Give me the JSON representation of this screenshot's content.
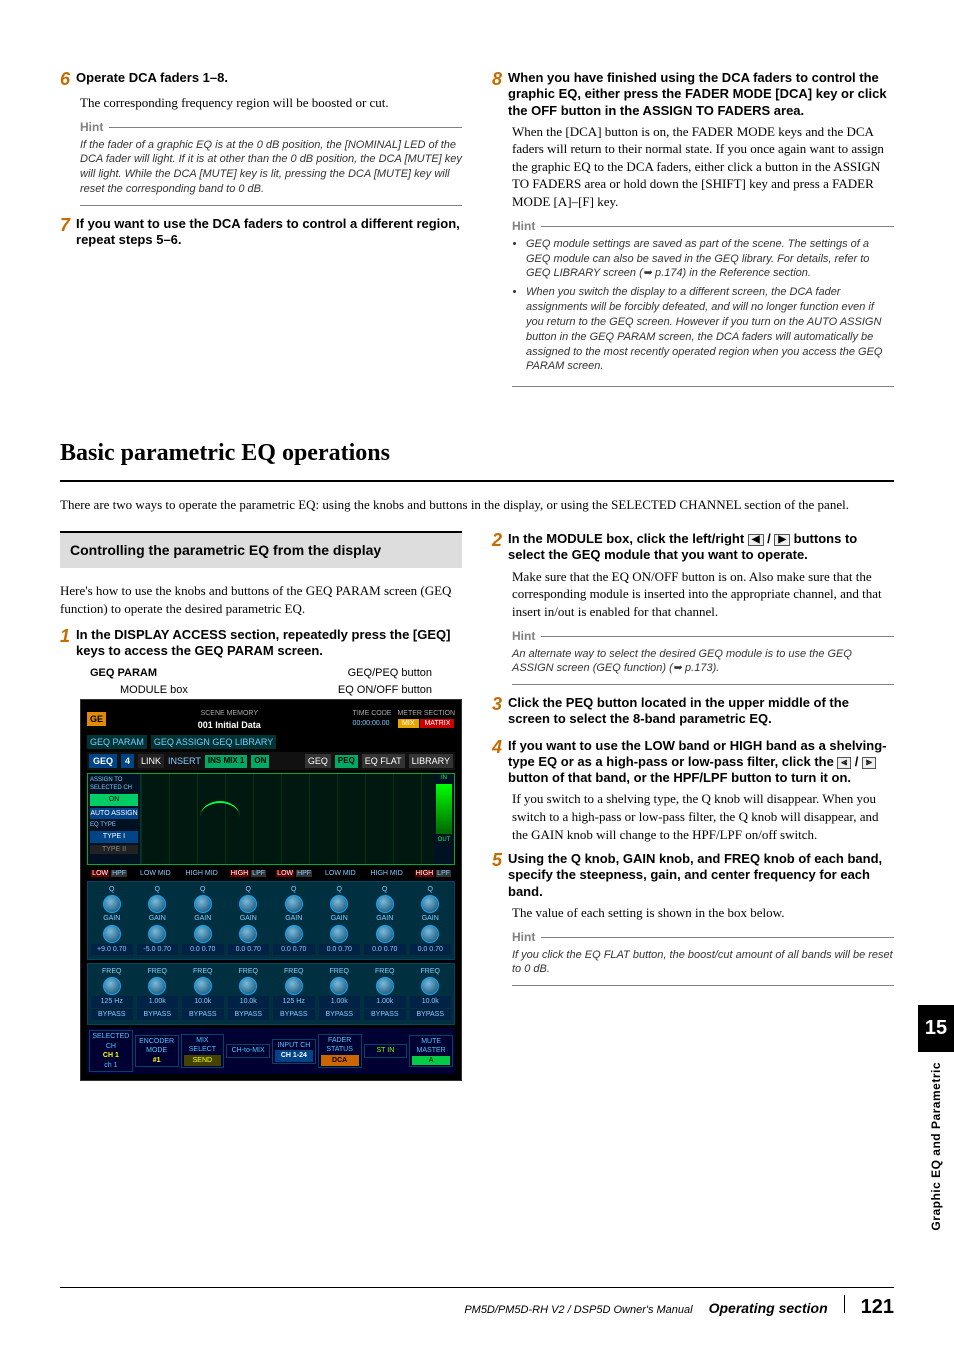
{
  "colA": {
    "step6": {
      "num": "6",
      "head": "Operate DCA faders 1–8.",
      "body": "The corresponding frequency region will be boosted or cut.",
      "hint_label": "Hint",
      "hint_body": "If the fader of a graphic EQ is at the 0 dB position, the [NOMINAL] LED of the DCA fader will light. If it is at other than the 0 dB position, the DCA [MUTE] key will light. While the DCA [MUTE] key is lit, pressing the DCA [MUTE] key will reset the corresponding band to 0 dB."
    },
    "step7": {
      "num": "7",
      "head": "If you want to use the DCA faders to control a different region, repeat steps 5–6."
    }
  },
  "colB": {
    "step8": {
      "num": "8",
      "head": "When you have finished using the DCA faders to control the graphic EQ, either press the FADER MODE [DCA] key or click the OFF button in the ASSIGN TO FADERS area.",
      "body": "When the [DCA] button is on, the FADER MODE keys and the DCA faders will return to their normal state. If you once again want to assign the graphic EQ to the DCA faders, either click a button in the ASSIGN TO FADERS area or hold down the [SHIFT] key and press a FADER MODE [A]–[F] key.",
      "hint_label": "Hint",
      "hint_li1": "GEQ module settings are saved as part of the scene. The settings of a GEQ module can also be saved in the GEQ library. For details, refer to GEQ LIBRARY screen (➥ p.174) in the Reference section.",
      "hint_li2": "When you switch the display to a different screen, the DCA fader assignments will be forcibly defeated, and will no longer function even if you return to the GEQ screen. However if you turn on the AUTO ASSIGN button in the GEQ PARAM screen, the DCA faders will automatically be assigned to the most recently operated region when you access the GEQ PARAM screen."
    }
  },
  "section_title": "Basic parametric EQ operations",
  "intro": "There are two ways to operate the parametric EQ: using the knobs and buttons in the display, or using the SELECTED CHANNEL section of the panel.",
  "leftcol": {
    "heading": "Controlling the parametric EQ from the display",
    "para": "Here's how to use the knobs and buttons of the GEQ PARAM screen (GEQ function) to operate the desired parametric EQ.",
    "step1": {
      "num": "1",
      "head": "In the DISPLAY ACCESS section, repeatedly press the [GEQ] keys to access the GEQ PARAM screen."
    },
    "fig": {
      "cap_param": "GEQ PARAM",
      "cap_peq": "GEQ/PEQ button",
      "cap_module": "MODULE box",
      "cap_eqon": "EQ ON/OFF button",
      "orange": "GE",
      "scene_lbl": "SCENE MEMORY",
      "scene": "001 Initial Data",
      "tc_lbl": "TIME CODE",
      "tc": "00:00:00.00",
      "meter": "METER SECTION",
      "mix": "MIX",
      "matrix": "MATRIX",
      "row_assign": "GEQ PARAM",
      "row_opt": "GEQ ASSIGN  GEQ LIBRARY",
      "geq": "GEQ",
      "geq_n": "4",
      "link": "LINK",
      "insert": "INSERT",
      "insmix": "INS MIX 1",
      "on": "ON",
      "geqb": "GEQ",
      "peqb": "PEQ",
      "flat": "EQ FLAT",
      "lib": "LIBRARY",
      "assign": "ASSIGN TO SELECTED CH",
      "onb": "ON",
      "auto": "AUTO ASSIGN",
      "eqt": "EQ TYPE",
      "t1": "TYPE I",
      "t2": "TYPE II",
      "low": "LOW",
      "lmid": "LOW MID",
      "hmid": "HIGH MID",
      "high": "HIGH",
      "q": "Q",
      "gain": "GAIN",
      "freq": "FREQ",
      "qv": "0.70",
      "gv": "+9.0",
      "gv2": "-5.0",
      "gv3": "0.0",
      "fv": "125 Hz",
      "fv2": "1.00k",
      "fv3": "10.0k",
      "byp": "BYPASS",
      "hpf": "HPF",
      "lpf": "LPF",
      "ins": "IN",
      "out": "OUT",
      "sel": "SELECTED CH",
      "ch1": "CH 1",
      "ch1b": "ch 1",
      "enc": "ENCODER MODE",
      "encv": "#1",
      "send": "SEND",
      "mixs": "MIX SELECT",
      "chl": "CH-to-MIX",
      "inp": "INPUT CH",
      "ch124": "CH 1-24",
      "fstat": "FADER STATUS",
      "dca": "DCA",
      "stin": "ST IN",
      "mute": "MUTE MASTER",
      "a": "A"
    }
  },
  "rightcol": {
    "step2": {
      "num": "2",
      "head_a": "In the MODULE box, click the left/right ",
      "head_b": " / ",
      "head_c": " buttons to select the GEQ module that you want to operate.",
      "body": "Make sure that the EQ ON/OFF button is on. Also make sure that the corresponding module is inserted into the appropriate channel, and that insert in/out is enabled for that channel.",
      "hint_label": "Hint",
      "hint_body": "An alternate way to select the desired GEQ module is to use the GEQ ASSIGN screen (GEQ function) (➥ p.173)."
    },
    "step3": {
      "num": "3",
      "head": "Click the PEQ button located in the upper middle of the screen to select the 8-band parametric EQ."
    },
    "step4": {
      "num": "4",
      "head_a": "If you want to use the LOW band or HIGH band as a shelving-type EQ or as a high-pass or low-pass filter, click the ",
      "head_b": " / ",
      "head_c": " button of that band, or the HPF/LPF button to turn it on.",
      "body": "If you switch to a shelving type, the Q knob will disappear. When you switch to a high-pass or low-pass filter, the Q knob will disappear, and the GAIN knob will change to the HPF/LPF on/off switch."
    },
    "step5": {
      "num": "5",
      "head": "Using the Q knob, GAIN knob, and FREQ knob of each band, specify the steepness, gain, and center frequency for each band.",
      "body": "The value of each setting is shown in the box below.",
      "hint_label": "Hint",
      "hint_body": "If you click the EQ FLAT button, the boost/cut amount of all bands will be reset to 0 dB."
    }
  },
  "side": {
    "num": "15",
    "text": "Graphic EQ and Parametric"
  },
  "footer": {
    "man": "PM5D/PM5D-RH V2 / DSP5D Owner's Manual",
    "sec": "Operating section",
    "page": "121"
  }
}
